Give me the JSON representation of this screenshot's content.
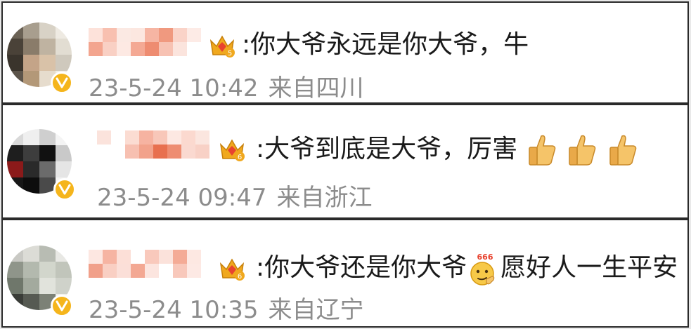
{
  "colors": {
    "text": "#1a1a1a",
    "meta": "#8c8c8c",
    "verified_badge": "#f5b51c",
    "crown_gold": "#f0a81e",
    "crown_red": "#e8432f"
  },
  "comments": [
    {
      "level": "5",
      "text": ":你大爷永远是你大爷，牛",
      "time": "23-5-24 10:42",
      "location": "来自四川",
      "emojis": []
    },
    {
      "level": "6",
      "text": ":大爷到底是大爷，厉害",
      "time": "23-5-24 09:47",
      "location": "来自浙江",
      "emojis": [
        "thumbs-up-icon",
        "thumbs-up-icon",
        "thumbs-up-icon"
      ]
    },
    {
      "level": "6",
      "text_before_emoji": ":你大爷还是你大爷",
      "emoji_label": "666",
      "text_after_emoji": "愿好人一生平安",
      "time": "23-5-24 10:35",
      "location": "来自辽宁",
      "emojis": [
        "666-thinking-emoji-icon"
      ]
    }
  ]
}
